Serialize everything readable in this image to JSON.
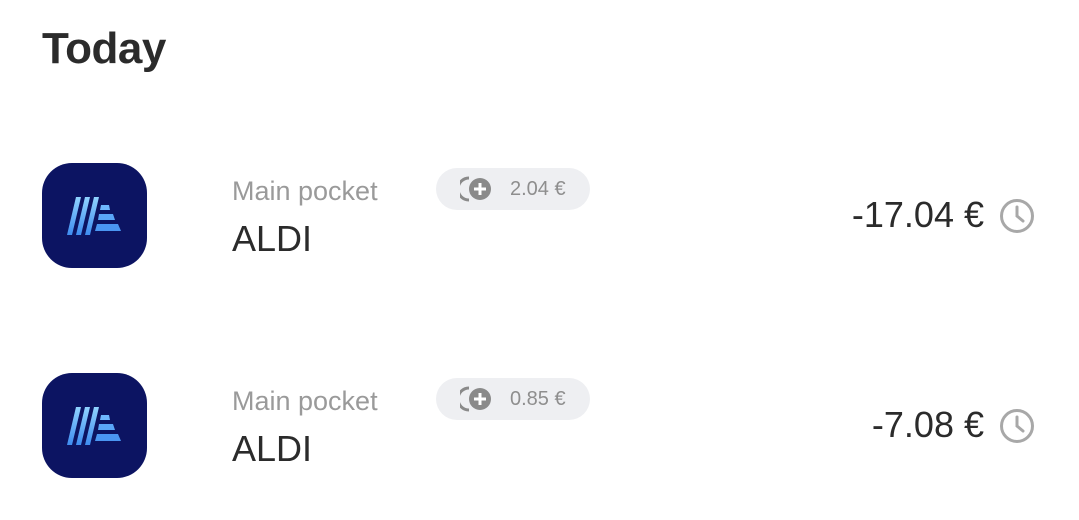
{
  "section": {
    "title": "Today"
  },
  "transactions": [
    {
      "pocket": "Main pocket",
      "merchant": "ALDI",
      "roundup": "2.04 €",
      "amount": "-17.04 €",
      "icons": {
        "logo": "aldi-logo",
        "roundup": "coin-plus-icon",
        "status": "clock-icon"
      }
    },
    {
      "pocket": "Main pocket",
      "merchant": "ALDI",
      "roundup": "0.85 €",
      "amount": "-7.08 €",
      "icons": {
        "logo": "aldi-logo",
        "roundup": "coin-plus-icon",
        "status": "clock-icon"
      }
    }
  ],
  "colors": {
    "logo_bg": "#0c1462",
    "pill_bg": "#eeeff2",
    "muted_text": "#9a9a9a",
    "primary_text": "#2b2b2b"
  }
}
